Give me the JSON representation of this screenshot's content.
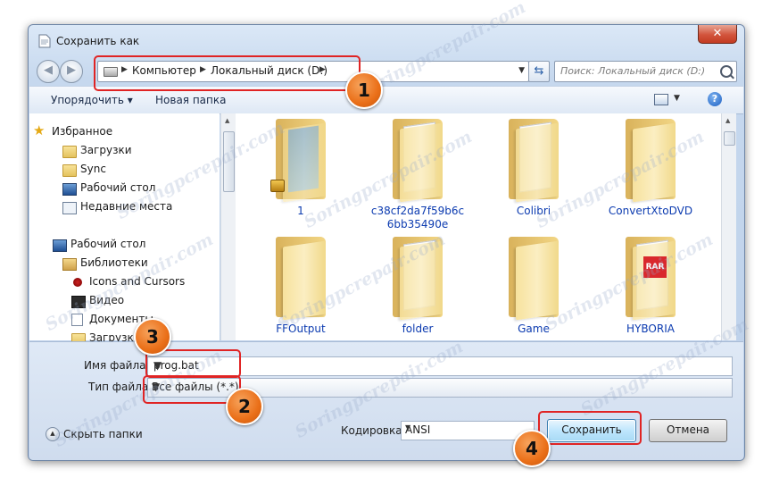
{
  "window": {
    "title": "Сохранить как",
    "close_label": "✕"
  },
  "address": {
    "crumbs": [
      "Компьютер",
      "Локальный диск (D:)"
    ],
    "search_placeholder": "Поиск: Локальный диск (D:)"
  },
  "toolbar": {
    "organize_label": "Упорядочить ▾",
    "new_folder_label": "Новая папка"
  },
  "sidebar": {
    "items": [
      {
        "label": "Избранное",
        "icon": "star-icon"
      },
      {
        "label": "Загрузки",
        "icon": "downloads-folder-icon"
      },
      {
        "label": "Sync",
        "icon": "folder-icon"
      },
      {
        "label": "Рабочий стол",
        "icon": "desktop-icon"
      },
      {
        "label": "Недавние места",
        "icon": "recent-places-icon"
      },
      {
        "label": "Рабочий стол",
        "icon": "desktop-icon"
      },
      {
        "label": "Библиотеки",
        "icon": "libraries-icon"
      },
      {
        "label": "Icons and Cursors",
        "icon": "icons-icon"
      },
      {
        "label": "Видео",
        "icon": "video-icon"
      },
      {
        "label": "Документы",
        "icon": "documents-icon"
      },
      {
        "label": "Загрузки",
        "icon": "downloads-folder-icon"
      }
    ]
  },
  "files": [
    {
      "name": "1",
      "kind": "blue"
    },
    {
      "name": "c38cf2da7f59b6c",
      "name2": "6bb35490e",
      "kind": "paper"
    },
    {
      "name": "Colibri",
      "kind": "paper"
    },
    {
      "name": "ConvertXtoDVD",
      "kind": "plain"
    },
    {
      "name": "FFOutput",
      "kind": "plain"
    },
    {
      "name": "folder",
      "kind": "paper"
    },
    {
      "name": "Game",
      "kind": "plain"
    },
    {
      "name": "HYBORIA",
      "kind": "rar"
    }
  ],
  "form": {
    "filename_label": "Имя файла:",
    "filename_value": "prog.bat",
    "filetype_label": "Тип файла:",
    "filetype_value": "Все файлы  (*.*)",
    "hide_folders_label": "Скрыть папки",
    "encoding_label": "Кодировка:",
    "encoding_value": "ANSI",
    "save_label": "Сохранить",
    "cancel_label": "Отмена"
  },
  "markers": {
    "n1": "1",
    "n2": "2",
    "n3": "3",
    "n4": "4"
  },
  "watermark": "Soringpcrepair.com",
  "colors": {
    "marker_red": "#e02424",
    "badge_orange": "#ea6f18",
    "link_blue": "#0c3bb0"
  }
}
